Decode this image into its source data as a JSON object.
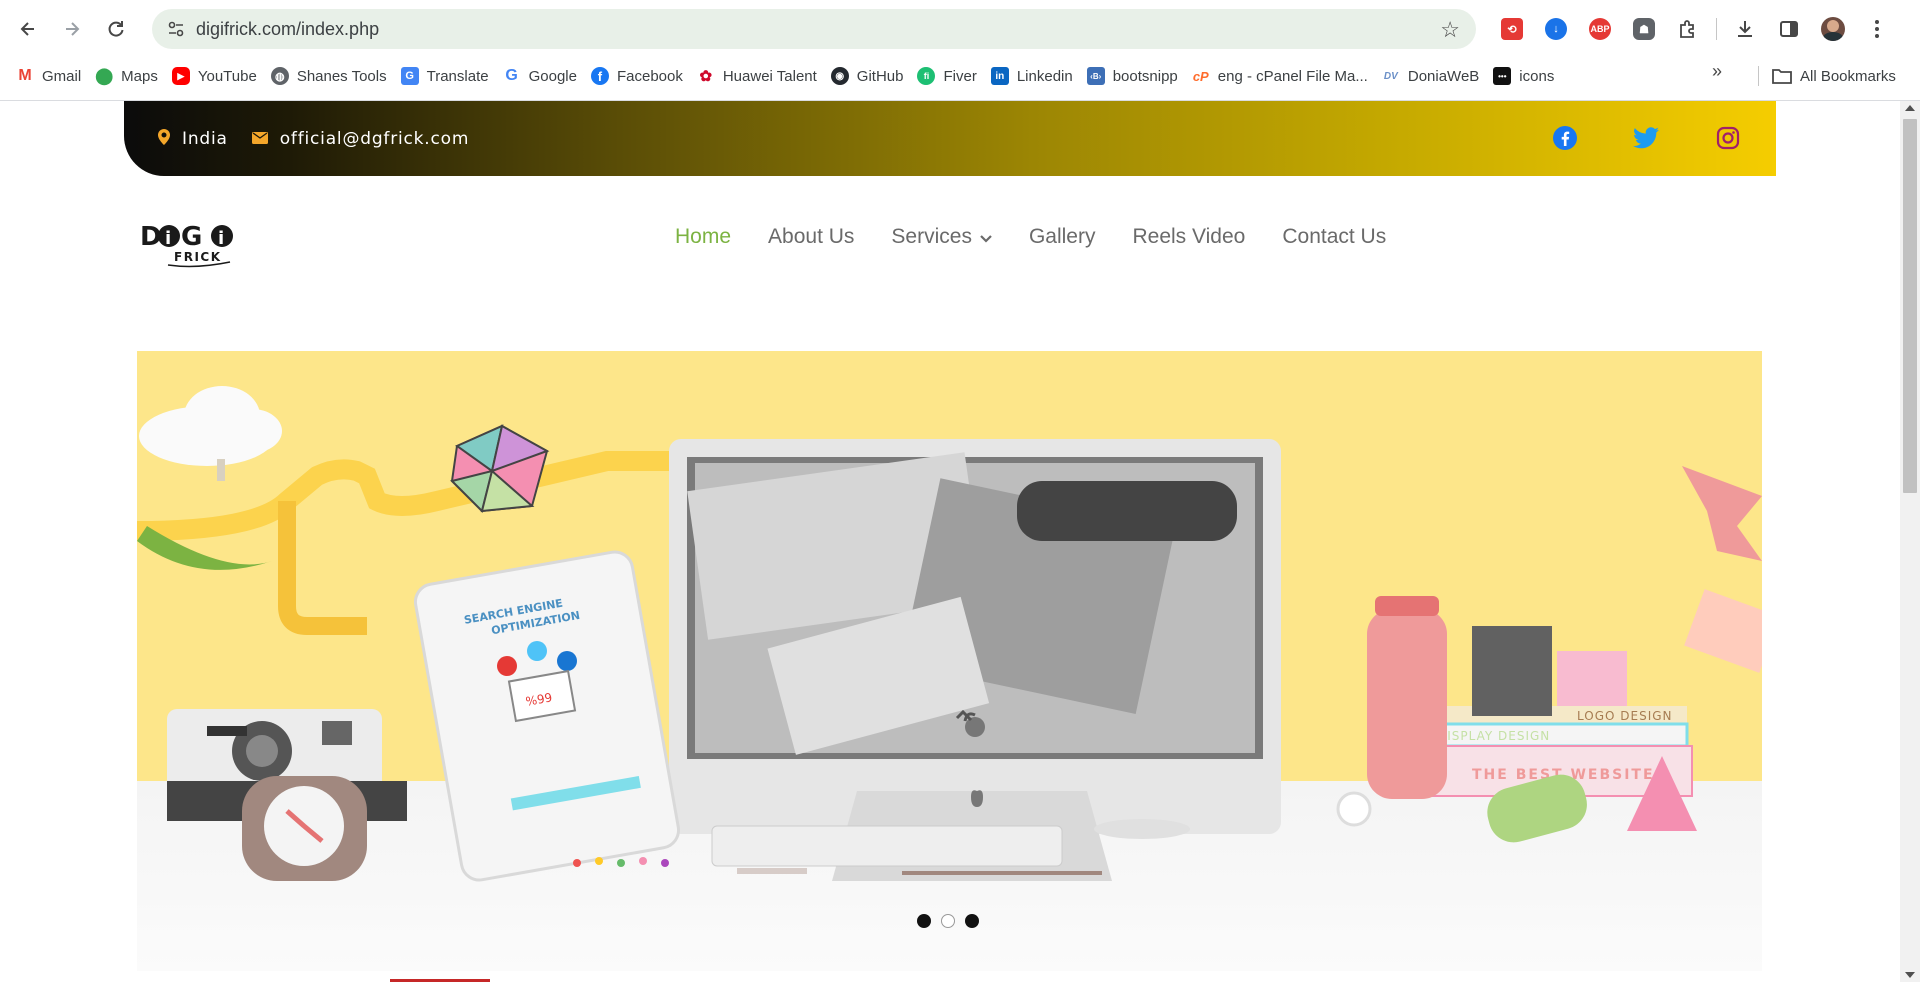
{
  "browser": {
    "url": "digifrick.com/index.php",
    "bookmarks": [
      {
        "label": "Gmail",
        "icon": "gmail-icon",
        "color": "#ea4335",
        "glyph": "M"
      },
      {
        "label": "Maps",
        "icon": "maps-icon",
        "color": "#34a853",
        "glyph": "●"
      },
      {
        "label": "YouTube",
        "icon": "youtube-icon",
        "color": "#ff0000",
        "glyph": "▶"
      },
      {
        "label": "Shanes Tools",
        "icon": "globe-icon",
        "color": "#5f6368",
        "glyph": "◍"
      },
      {
        "label": "Translate",
        "icon": "translate-icon",
        "color": "#4285f4",
        "glyph": "G"
      },
      {
        "label": "Google",
        "icon": "google-icon",
        "color": "#4285f4",
        "glyph": "G"
      },
      {
        "label": "Facebook",
        "icon": "facebook-icon",
        "color": "#1877f2",
        "glyph": "f"
      },
      {
        "label": "Huawei Talent",
        "icon": "huawei-icon",
        "color": "#cf0a2c",
        "glyph": "✿"
      },
      {
        "label": "GitHub",
        "icon": "github-icon",
        "color": "#24292f",
        "glyph": "◉"
      },
      {
        "label": "Fiver",
        "icon": "fiverr-icon",
        "color": "#1dbf73",
        "glyph": "fi"
      },
      {
        "label": "Linkedin",
        "icon": "linkedin-icon",
        "color": "#0a66c2",
        "glyph": "in"
      },
      {
        "label": "bootsnipp",
        "icon": "bootsnipp-icon",
        "color": "#3d6fb6",
        "glyph": "‹B›"
      },
      {
        "label": "eng - cPanel File Ma...",
        "icon": "cpanel-icon",
        "color": "#ff6c2c",
        "glyph": "cP"
      },
      {
        "label": "DoniaWeB",
        "icon": "doniaweb-icon",
        "color": "#9bb4d6",
        "glyph": "DV"
      },
      {
        "label": "icons",
        "icon": "icons-bookmark-icon",
        "color": "#111111",
        "glyph": "•••"
      }
    ],
    "all_bookmarks": "All Bookmarks"
  },
  "site": {
    "location": "India",
    "email": "official@dgfrick.com",
    "menu": [
      {
        "label": "Home",
        "active": true
      },
      {
        "label": "About Us",
        "active": false
      },
      {
        "label": "Services",
        "active": false
      },
      {
        "label": "Gallery",
        "active": false
      },
      {
        "label": "Reels Video",
        "active": false
      },
      {
        "label": "Contact Us",
        "active": false
      }
    ],
    "hero": {
      "slide_dots": 3,
      "active_dot": 2,
      "book_labels": [
        "LOGO DESIGN",
        "DISPLAY DESIGN",
        "THE BEST WEBSITES"
      ],
      "tablet_text": [
        "SEARCH ENGINE",
        "OPTIMIZATION",
        "%99"
      ]
    },
    "colors": {
      "accent_green": "#7cb342",
      "topbar_start": "#0b0b0b",
      "topbar_end": "#f5cd00",
      "hero_bg": "#fde68a"
    }
  }
}
